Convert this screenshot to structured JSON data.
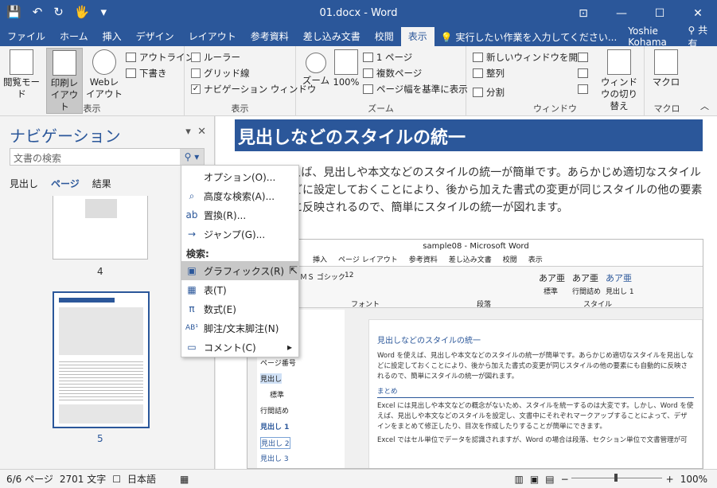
{
  "title": "01.docx - Word",
  "qat": [
    "💾",
    "↶",
    "↻",
    "🖐",
    "▾"
  ],
  "window_controls": [
    "⊡",
    "—",
    "☐",
    "✕"
  ],
  "tabs": [
    "ファイル",
    "ホーム",
    "挿入",
    "デザイン",
    "レイアウト",
    "参考資料",
    "差し込み文書",
    "校閲",
    "表示"
  ],
  "active_tab": "表示",
  "tell_me": "実行したい作業を入力してください...",
  "user": "Yoshie Kohama",
  "share": "共有",
  "ribbon": {
    "views": {
      "read": "閲覧モード",
      "print": "印刷レイアウト",
      "web": "Webレイアウト",
      "outline": "アウトライン",
      "draft": "下書き",
      "label": "表示"
    },
    "show": {
      "ruler": "ルーラー",
      "grid": "グリッド線",
      "navpane": "ナビゲーション ウィンドウ",
      "label": "表示"
    },
    "zoom": {
      "zoom": "ズーム",
      "hundred": "100%",
      "onepage": "1 ページ",
      "multi": "複数ページ",
      "pagewidth": "ページ幅を基準に表示",
      "label": "ズーム"
    },
    "window": {
      "newwin": "新しいウィンドウを開く",
      "arrange": "整列",
      "split": "分割",
      "switch": "ウィンドウの切り替え",
      "label": "ウィンドウ"
    },
    "macro": {
      "macro": "マクロ",
      "label": "マクロ"
    }
  },
  "nav": {
    "title": "ナビゲーション",
    "search_placeholder": "文書の検索",
    "tabs": [
      "見出し",
      "ページ",
      "結果"
    ],
    "active_tab": "ページ",
    "pages": [
      "4",
      "5"
    ]
  },
  "menu": {
    "items": [
      {
        "label": "オプション(O)...",
        "icon": ""
      },
      {
        "label": "高度な検索(A)...",
        "icon": "⌕"
      },
      {
        "label": "置換(R)...",
        "icon": "ab"
      },
      {
        "label": "ジャンプ(G)...",
        "icon": "→"
      }
    ],
    "header": "検索:",
    "find_items": [
      {
        "label": "グラフィックス(R)",
        "icon": "▣"
      },
      {
        "label": "表(T)",
        "icon": "▦"
      },
      {
        "label": "数式(E)",
        "icon": "π"
      },
      {
        "label": "脚注/文末脚注(N)",
        "icon": "AB¹"
      },
      {
        "label": "コメント(C)",
        "icon": "▭"
      }
    ],
    "submenu_arrow": "▸"
  },
  "doc": {
    "heading": "見出しなどのスタイルの統一",
    "body": "Word を使えば、見出しや本文などのスタイルの統一が簡単です。あらかじめ適切なスタイルを見出しなどに設定しておくことにより、後から加えた書式の変更が同じスタイルの他の要素にも自動的に反映されるので、簡単にスタイルの統一が図れます。"
  },
  "inner": {
    "title": "sample08 - Microsoft Word",
    "tabs": [
      "挿入",
      "ページ レイアウト",
      "参考資料",
      "差し込み文書",
      "校閲",
      "表示"
    ],
    "font": "ＭＳ ゴシック",
    "size": "12",
    "styles": [
      "あア亜",
      "あア亜",
      "あア亜"
    ],
    "style_names": [
      "標準",
      "行間詰め",
      "見出し 1"
    ],
    "group_font": "フォント",
    "group_para": "段落",
    "group_style": "スタイル",
    "nav_items": [
      "ページ番号",
      "見出し",
      "標準",
      "行間詰め",
      "見出し 1",
      "見出し 2",
      "見出し 3"
    ],
    "page_heading": "見出しなどのスタイルの統一",
    "page_para1": "Word を使えば、見出しや本文などのスタイルの統一が簡単です。あらかじめ適切なスタイルを見出しなどに設定しておくことにより、後から加えた書式の変更が同じスタイルの他の要素にも自動的に反映されるので、簡単にスタイルの統一が図れます。",
    "page_sub": "まとめ",
    "page_para2": "Excel には見出しや本文などの概念がないため、スタイルを統一するのは大変です。しかし、Word を使えば、見出しや本文などのスタイルを設定し、文書中にそれぞれマークアップすることによって、デザインをまとめて修正したり、目次を作成したりすることが簡単にできます。",
    "page_para3": "Excel ではセル単位でデータを認識されますが、Word の場合は段落、セクション単位で文書管理が可"
  },
  "status": {
    "page": "6/6 ページ",
    "words": "2701 文字",
    "lang": "日本語",
    "zoom": "100%"
  }
}
